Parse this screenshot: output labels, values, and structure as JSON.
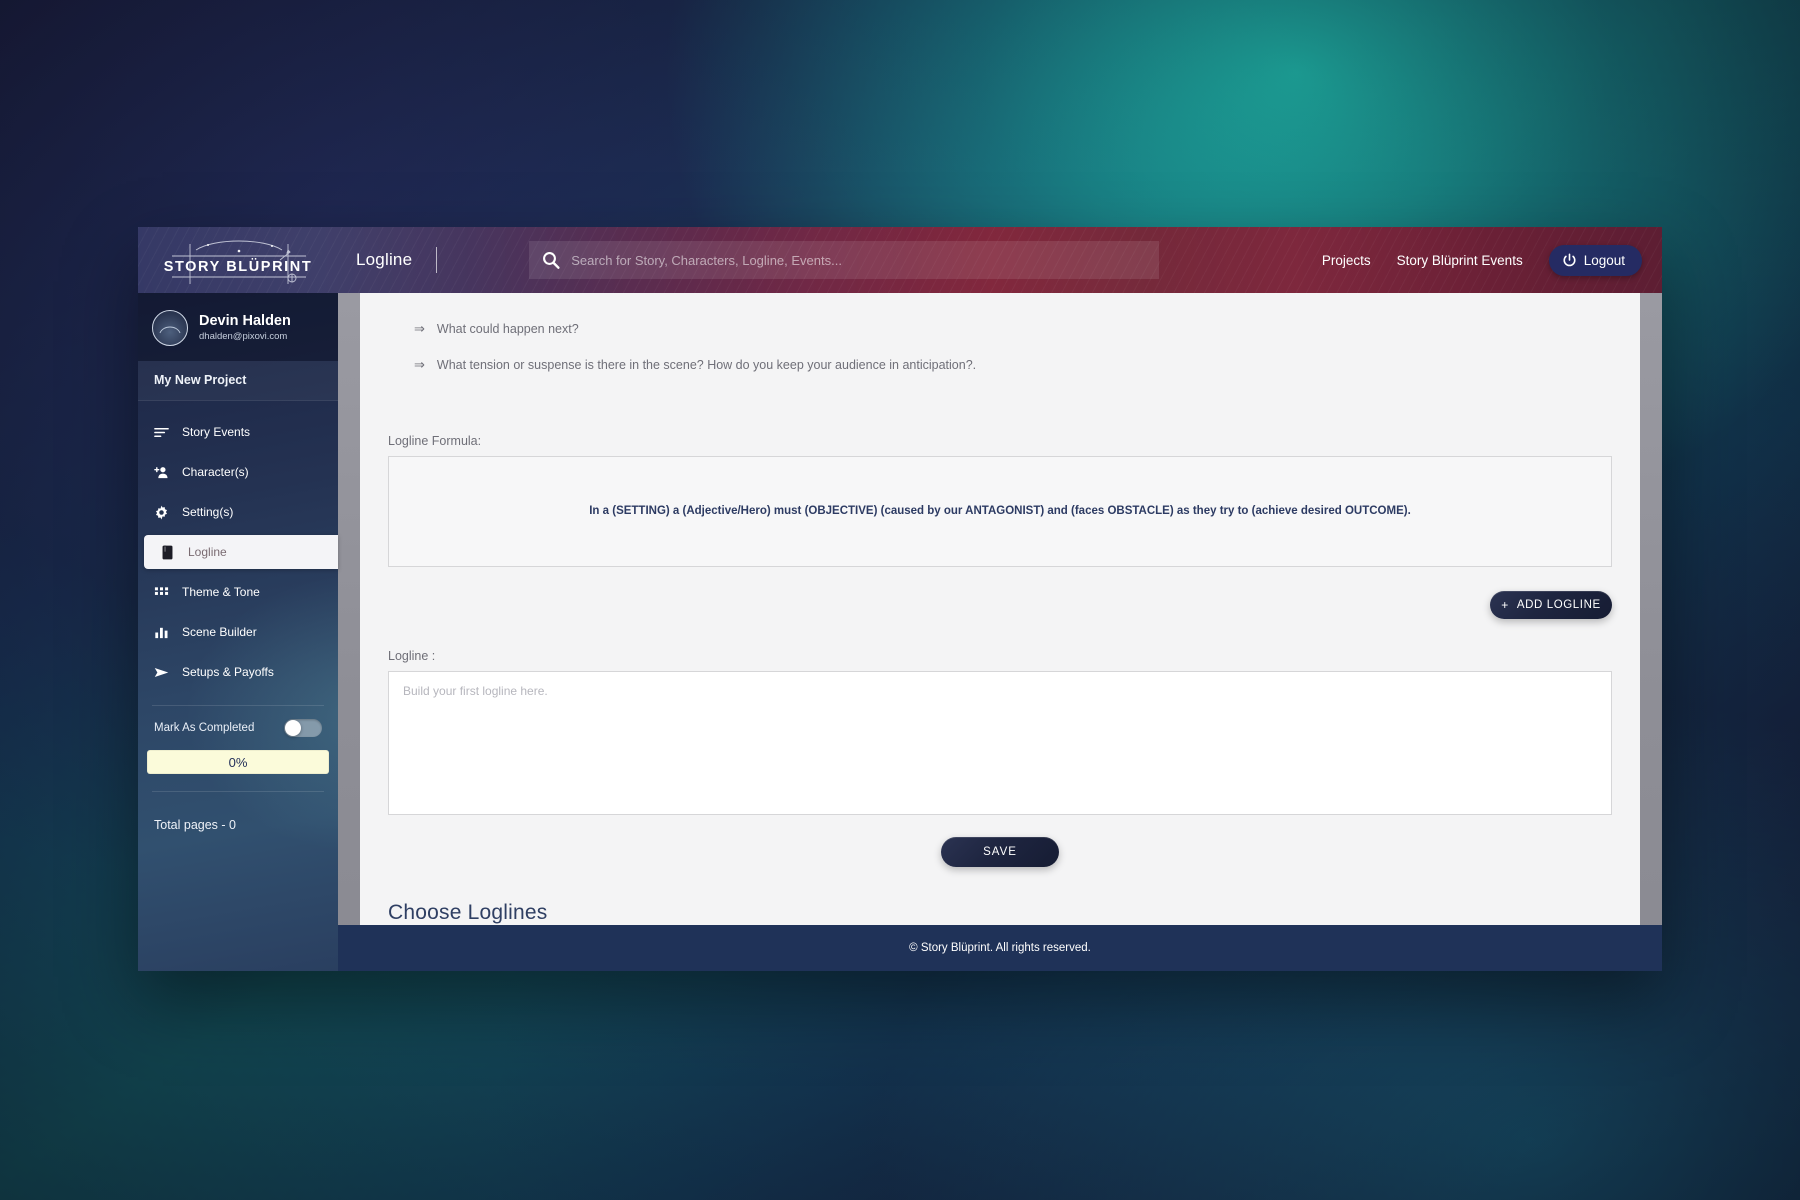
{
  "topbar": {
    "logo_text": "STORY BLÜPRINT",
    "page_title": "Logline",
    "search": {
      "placeholder": "Search for Story, Characters, Logline, Events...",
      "value": "",
      "icon": "search-icon"
    },
    "links": [
      {
        "label": "Projects"
      },
      {
        "label": "Story Blüprint Events"
      }
    ],
    "logout": {
      "label": "Logout",
      "icon": "power-icon"
    }
  },
  "sidebar": {
    "user": {
      "name": "Devin Halden",
      "email": "dhalden@pixovi.com",
      "avatar_label": "avatar"
    },
    "project": "My New Project",
    "items": [
      {
        "label": "Story Events",
        "icon": "list-lines-icon",
        "active": false
      },
      {
        "label": "Character(s)",
        "icon": "add-person-icon",
        "active": false
      },
      {
        "label": "Setting(s)",
        "icon": "gear-icon",
        "active": false
      },
      {
        "label": "Logline",
        "icon": "book-icon",
        "active": true
      },
      {
        "label": "Theme & Tone",
        "icon": "grid-icon",
        "active": false
      },
      {
        "label": "Scene Builder",
        "icon": "bar-chart-icon",
        "active": false
      },
      {
        "label": "Setups & Payoffs",
        "icon": "send-icon",
        "active": false
      }
    ],
    "mark_as_completed": {
      "label": "Mark As Completed",
      "checked": false
    },
    "progress": {
      "value": "0%",
      "percent": 0
    },
    "total_pages": "Total pages - 0"
  },
  "main": {
    "questions": [
      {
        "bullet": "⇒",
        "text": "What could happen next?"
      },
      {
        "bullet": "⇒",
        "text": "What tension or suspense is there in the scene? How do you keep your audience in anticipation?."
      }
    ],
    "formula_label": "Logline Formula:",
    "formula_text": "In a (SETTING) a (Adjective/Hero) must (OBJECTIVE) (caused by our ANTAGONIST) and (faces OBSTACLE) as they try to (achieve desired OUTCOME).",
    "add_logline_button": {
      "label": "ADD LOGLINE",
      "plus": "+"
    },
    "logline_label": "Logline :",
    "logline_input": {
      "value": "",
      "placeholder": "Build your first logline here."
    },
    "save_button": {
      "label": "SAVE"
    },
    "choose_heading": "Choose Loglines"
  },
  "footer": {
    "text": "© Story Blüprint. All rights reserved."
  },
  "colors": {
    "accent_navy": "#252b63",
    "progress_bg": "#fbfbda",
    "progress_text": "#23305a",
    "footer_bg": "#1f3258",
    "formula_text": "#2d3b63",
    "heading": "#2f3f63"
  }
}
